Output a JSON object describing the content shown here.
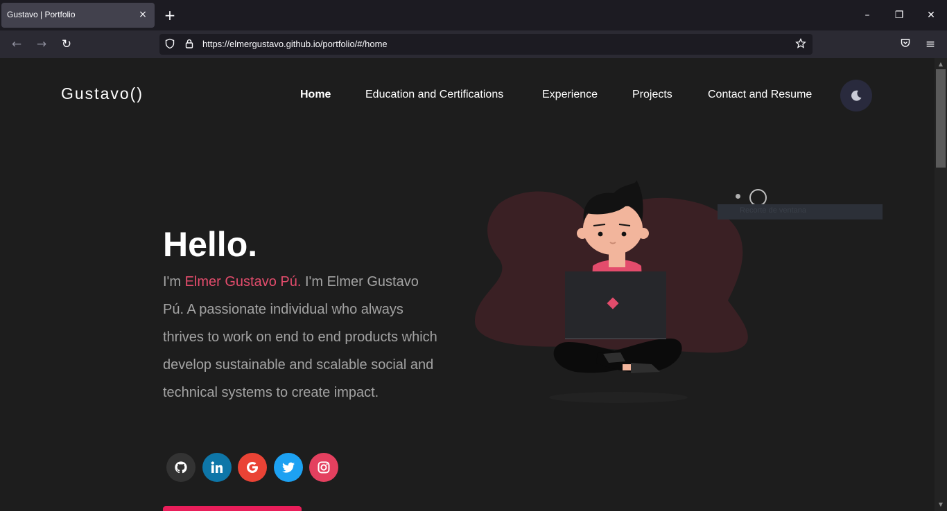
{
  "browser": {
    "tab_title": "Gustavo | Portfolio",
    "tab_close": "×",
    "new_tab": "+",
    "url": "https://elmergustavo.github.io/portfolio/#/home",
    "window": {
      "minimize": "–",
      "restore": "❐",
      "close": "✕"
    }
  },
  "site": {
    "logo": "Gustavo()",
    "nav": [
      {
        "label": "Home",
        "active": true
      },
      {
        "label": "Education and Certifications"
      },
      {
        "label": "Experience"
      },
      {
        "label": "Projects"
      },
      {
        "label": "Contact and Resume"
      }
    ],
    "theme_icon": "moon-icon"
  },
  "hero": {
    "greeting": "Hello.",
    "intro_prefix": "I'm ",
    "name": "Elmer Gustavo Pú.",
    "intro_rest": " I'm Elmer Gustavo Pú. A passionate individual who always thrives to work on end to end products which develop sustainable and scalable social and technical systems to create impact."
  },
  "social": [
    {
      "icon": "github-icon",
      "color": "#333333"
    },
    {
      "icon": "linkedin-icon",
      "color": "#0e76a8"
    },
    {
      "icon": "google-icon",
      "color": "#ea4335"
    },
    {
      "icon": "twitter-icon",
      "color": "#1da1f2"
    },
    {
      "icon": "instagram-icon",
      "color": "#e4405f"
    }
  ],
  "overlay": {
    "snip_label": "Recorte de ventana"
  },
  "colors": {
    "accent": "#e34c6c",
    "background": "#1d1d1d",
    "cta": "#e91e5a"
  }
}
